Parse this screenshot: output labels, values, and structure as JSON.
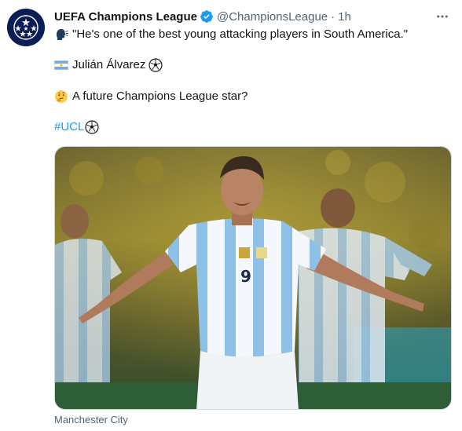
{
  "tweet": {
    "account": {
      "display_name": "UEFA Champions League",
      "handle": "@ChampionsLeague",
      "separator": "·",
      "time": "1h",
      "avatar_icon": "starball-logo",
      "verified_icon": "verified-badge-icon"
    },
    "text": {
      "line1": "\"He's one of the best young attacking players in South America.\"",
      "line1_icon": "speaking-head-icon",
      "line2": "Julián Álvarez",
      "line2_icon_before": "argentina-flag-icon",
      "line2_icon_after": "soccer-ball-icon",
      "line3": "A future Champions League star?",
      "line3_icon": "thinking-face-icon",
      "hashtag": "#UCL",
      "hashtag_icon": "soccer-ball-icon"
    },
    "media": {
      "description_icon": "player-celebration-photo"
    },
    "source_label": "Manchester City"
  },
  "colors": {
    "text": "#0f1419",
    "secondary": "#536471",
    "link": "#1d9bf0",
    "verified": "#1d9bf0"
  }
}
